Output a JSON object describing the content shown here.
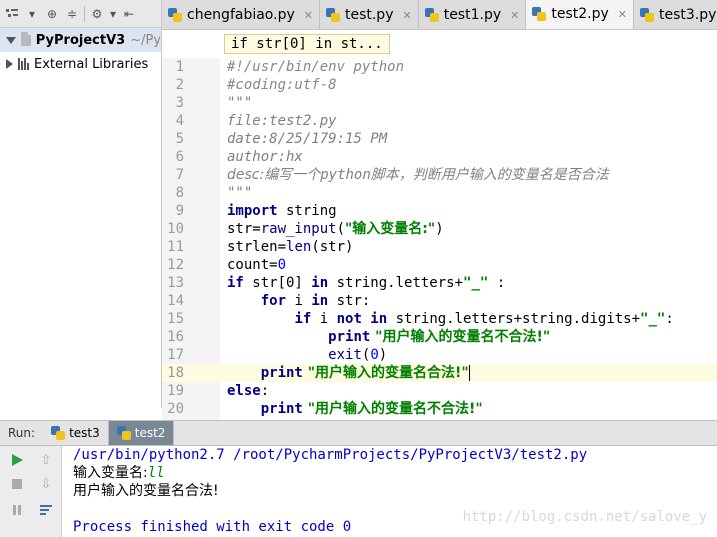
{
  "project_panel": {
    "toolbar_icons": [
      "tree-icon",
      "chevron-down-icon",
      "target-icon",
      "collapse-icon",
      "gear-icon",
      "hide-icon"
    ],
    "tree": [
      {
        "label": "PyProjectV3",
        "path": "~/Py",
        "expanded": true
      },
      {
        "label": "External Libraries",
        "expanded": false
      }
    ]
  },
  "tabs": [
    {
      "label": "chengfabiao.py",
      "active": false
    },
    {
      "label": "test.py",
      "active": false
    },
    {
      "label": "test1.py",
      "active": false
    },
    {
      "label": "test2.py",
      "active": true
    },
    {
      "label": "test3.py",
      "active": false
    }
  ],
  "editor": {
    "breadcrumb": "if str[0] in st...",
    "line_numbers": [
      "1",
      "2",
      "3",
      "4",
      "5",
      "6",
      "7",
      "8",
      "9",
      "10",
      "11",
      "12",
      "13",
      "14",
      "15",
      "16",
      "17",
      "18",
      "19",
      "20"
    ],
    "current_line": 18,
    "lines": {
      "l1": "#!/usr/bin/env python",
      "l2": "#coding:utf-8",
      "l3": "\"\"\"",
      "l4": "file:test2.py",
      "l5": "date:8/25/179:15 PM",
      "l6": "author:hx",
      "l7a": "desc:编写一个",
      "l7b": "python",
      "l7c": "脚本，判断用户输入的变量名是否合法",
      "l8": "\"\"\"",
      "l9kw": "import",
      "l9": " string",
      "l10a": "str=",
      "l10b": "raw_input",
      "l10c": "(",
      "l10d": "\"输入变量名:\"",
      "l10e": ")",
      "l11a": "strlen=",
      "l11b": "len",
      "l11c": "(str)",
      "l12a": "count=",
      "l12b": "0",
      "l13kw": "if",
      "l13a": " str[0] ",
      "l13kw2": "in",
      "l13b": " string.letters+",
      "l13s": "\"_\"",
      "l13c": " :",
      "l14ind": "    ",
      "l14kw": "for",
      "l14a": " i ",
      "l14kw2": "in",
      "l14b": " str:",
      "l15ind": "        ",
      "l15kw": "if",
      "l15a": " i ",
      "l15kw2": "not in",
      "l15b": " string.letters+string.digits+",
      "l15s": "\"_\"",
      "l15c": ":",
      "l16ind": "            ",
      "l16kw": "print",
      "l16s": " \"用户输入的变量名不合法!\"",
      "l17ind": "            ",
      "l17a": "exit",
      "l17b": "(",
      "l17n": "0",
      "l17c": ")",
      "l18ind": "    ",
      "l18kw": "print",
      "l18s": " \"用户输入的变量名合法!\"",
      "l19kw": "else",
      "l19a": ":",
      "l20ind": "    ",
      "l20kw": "print",
      "l20s": " \"用户输入的变量名不合法!\""
    }
  },
  "run_panel": {
    "label": "Run:",
    "tabs": [
      {
        "label": "test3",
        "active": false
      },
      {
        "label": "test2",
        "active": true
      }
    ],
    "console": {
      "cmd": "/usr/bin/python2.7 /root/PycharmProjects/PyProjectV3/test2.py",
      "prompt": "输入变量名:",
      "input": "ll",
      "result": "用户输入的变量名合法!",
      "finish": "Process finished with exit code 0"
    }
  },
  "watermark": "http://blog.csdn.net/salove_y",
  "colors": {
    "keyword": "#000080",
    "string": "#008000",
    "number": "#0000ff",
    "comment": "#888888",
    "current_line": "#fffbe0"
  }
}
